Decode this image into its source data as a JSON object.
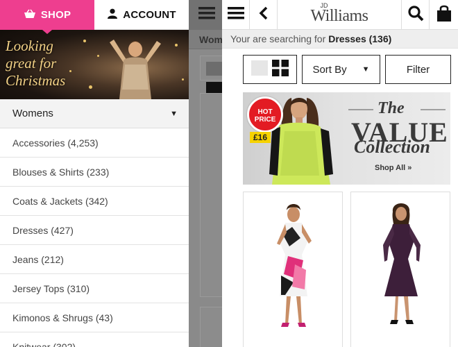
{
  "drawer": {
    "shop_label": "SHOP",
    "account_label": "ACCOUNT",
    "promo_text": [
      "Looking",
      "great for",
      "Christmas"
    ],
    "section_label": "Womens",
    "categories": [
      "Accessories (4,253)",
      "Blouses & Shirts (233)",
      "Coats & Jackets (342)",
      "Dresses (427)",
      "Jeans (212)",
      "Jersey Tops (310)",
      "Kimonos & Shrugs (43)",
      "Knitwear (302)"
    ]
  },
  "background_page": {
    "heading_fragment": "Wome"
  },
  "header": {
    "logo_jd": "JD",
    "logo_name": "Williams"
  },
  "search": {
    "prefix": "Your are searching for",
    "term": "Dresses (136)"
  },
  "controls": {
    "sort_label": "Sort By",
    "filter_label": "Filter"
  },
  "banner": {
    "badge_line1": "HOT",
    "badge_line2": "PRICE",
    "price": "£16",
    "the": "The",
    "value": "VALUE",
    "collection": "Collection",
    "shop_all": "Shop All »"
  },
  "colors": {
    "shop_pink": "#ee3e8f",
    "hot_red": "#e31b23",
    "price_yellow": "#f6d200",
    "dim_overlay": "#8a8a8a"
  }
}
